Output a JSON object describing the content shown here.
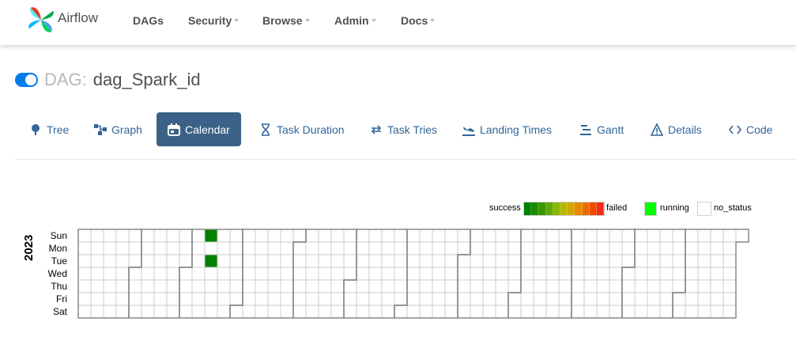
{
  "brand": {
    "name": "Airflow"
  },
  "nav": [
    {
      "label": "DAGs",
      "dropdown": false
    },
    {
      "label": "Security",
      "dropdown": true
    },
    {
      "label": "Browse",
      "dropdown": true
    },
    {
      "label": "Admin",
      "dropdown": true
    },
    {
      "label": "Docs",
      "dropdown": true
    }
  ],
  "dag": {
    "prefix": "DAG:",
    "id": "dag_Spark_id",
    "paused": false
  },
  "tabs": [
    {
      "label": "Tree",
      "icon": "tree-icon",
      "active": false
    },
    {
      "label": "Graph",
      "icon": "graph-icon",
      "active": false
    },
    {
      "label": "Calendar",
      "icon": "calendar-icon",
      "active": true
    },
    {
      "label": "Task Duration",
      "icon": "hourglass-icon",
      "active": false
    },
    {
      "label": "Task Tries",
      "icon": "retry-icon",
      "active": false
    },
    {
      "label": "Landing Times",
      "icon": "landing-icon",
      "active": false
    },
    {
      "label": "Gantt",
      "icon": "gantt-icon",
      "active": false
    },
    {
      "label": "Details",
      "icon": "warning-triangle-icon",
      "active": false
    },
    {
      "label": "Code",
      "icon": "code-icon",
      "active": false
    }
  ],
  "legend": {
    "success_label": "success",
    "failed_label": "failed",
    "running_label": "running",
    "no_status_label": "no_status",
    "gradient_colors": [
      "#008000",
      "#1a8a00",
      "#3a9700",
      "#60a800",
      "#8ab500",
      "#b5b800",
      "#d6a300",
      "#e68a00",
      "#ec6c00",
      "#f24a00",
      "#f52a1a"
    ],
    "running_color": "#00ff00",
    "no_status_color": "#ffffff"
  },
  "calendar": {
    "year": "2023",
    "day_labels": [
      "Sun",
      "Mon",
      "Tue",
      "Wed",
      "Thu",
      "Fri",
      "Sat"
    ],
    "start_weekday": 0,
    "days_in_months": [
      31,
      28,
      31,
      30,
      31,
      30,
      31,
      31,
      30,
      31,
      30,
      31
    ],
    "success_color": "#008000",
    "runs": [
      {
        "week": 10,
        "day": 0,
        "status": "success"
      },
      {
        "week": 10,
        "day": 2,
        "status": "success"
      }
    ]
  }
}
